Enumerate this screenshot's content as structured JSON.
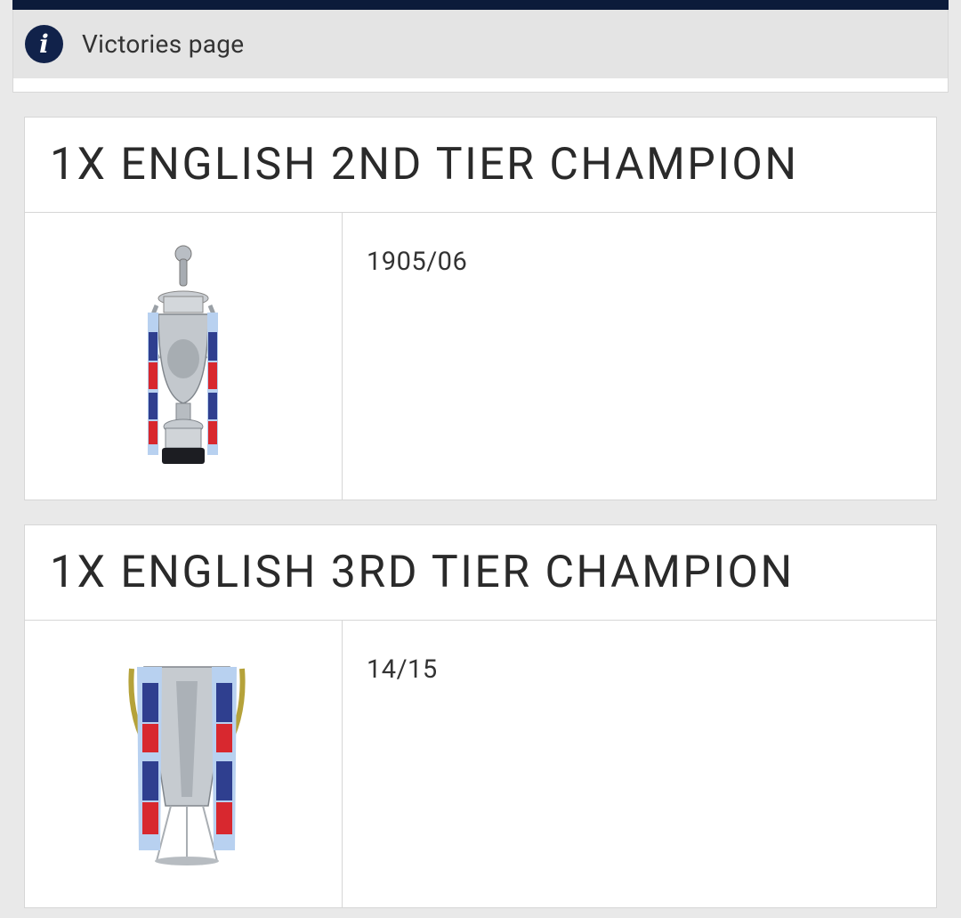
{
  "notice": {
    "icon": "info-icon",
    "text": "Victories page"
  },
  "honours": [
    {
      "title": "1X ENGLISH 2ND TIER CHAMPION",
      "trophy_icon": "championship-trophy-image",
      "seasons": "1905/06"
    },
    {
      "title": "1X ENGLISH 3RD TIER CHAMPION",
      "trophy_icon": "league-one-trophy-image",
      "seasons": "14/15"
    }
  ],
  "colors": {
    "header_bar": "#0c1b3a",
    "info_icon_bg": "#11224a",
    "ribbon_blue": "#2f3f8f",
    "ribbon_red": "#d8282f"
  }
}
